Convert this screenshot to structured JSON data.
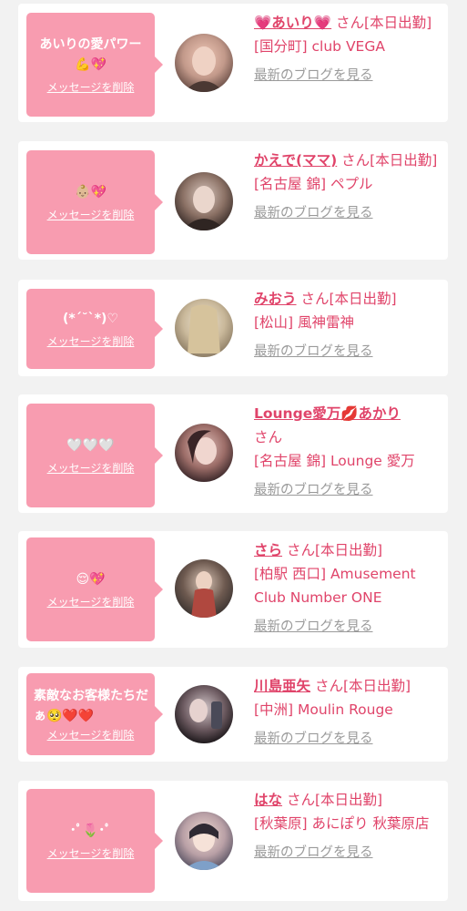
{
  "entries": [
    {
      "message_text": "あいりの愛パワー",
      "message_emoji": "💪💖",
      "delete_label": "メッセージを削除",
      "name": "💗あいり💗",
      "suffix": " さん[本日出勤]",
      "shop": "[国分町] club VEGA",
      "blog_label": "最新のブログを見る",
      "avatar_colors": [
        "#f1c9b8",
        "#c2998a",
        "#6d5149"
      ]
    },
    {
      "message_text": "",
      "message_emoji": "👶🏼💖",
      "delete_label": "メッセージを削除",
      "name": "かえで(ママ)",
      "suffix": " さん[本日出勤]",
      "shop": "[名古屋 錦] ペプル",
      "blog_label": "最新のブログを見る",
      "avatar_colors": [
        "#d9c8bf",
        "#8b7165",
        "#3d302c"
      ]
    },
    {
      "message_text": "(*´˘`*)♡",
      "message_emoji": "",
      "delete_label": "メッセージを削除",
      "name": "みおう",
      "suffix": " さん[本日出勤]",
      "shop": "[松山] 風神雷神",
      "blog_label": "最新のブログを見る",
      "avatar_colors": [
        "#efe6d5",
        "#c9b89a",
        "#8e7e66"
      ]
    },
    {
      "message_text": "",
      "message_emoji": "🤍🤍🤍",
      "delete_label": "メッセージを削除",
      "name": "Lounge愛万💋あかり",
      "suffix": " さん",
      "shop": "[名古屋 錦] Lounge 愛万",
      "blog_label": "最新のブログを見る",
      "avatar_colors": [
        "#e4c3bd",
        "#9c6d68",
        "#3e2a2c"
      ]
    },
    {
      "message_text": "",
      "message_emoji": "😌💖",
      "delete_label": "メッセージを削除",
      "name": "さら",
      "suffix": " さん[本日出勤]",
      "shop": "[柏駅 西口] Amusement Club Number ONE",
      "blog_label": "最新のブログを見る",
      "avatar_colors": [
        "#d8c4b5",
        "#b0483f",
        "#3c3431"
      ]
    },
    {
      "message_text": "素敵なお客様たちだぁ",
      "message_emoji": "🥺❤️❤️",
      "delete_label": "メッセージを削除",
      "name": "川島亜矢",
      "suffix": " さん[本日出勤]",
      "shop": "[中洲] Moulin Rouge",
      "blog_label": "最新のブログを見る",
      "avatar_colors": [
        "#d2c6c9",
        "#6c5a60",
        "#1f1a1d"
      ]
    },
    {
      "message_text": "･ﾟ🌷･ﾟ",
      "message_emoji": "",
      "delete_label": "メッセージを削除",
      "name": "はな",
      "suffix": " さん[本日出勤]",
      "shop": "[秋葉原] あにぽり 秋葉原店",
      "blog_label": "最新のブログを見る",
      "avatar_colors": [
        "#f1dcd2",
        "#b9a0a6",
        "#5e5767"
      ]
    }
  ]
}
